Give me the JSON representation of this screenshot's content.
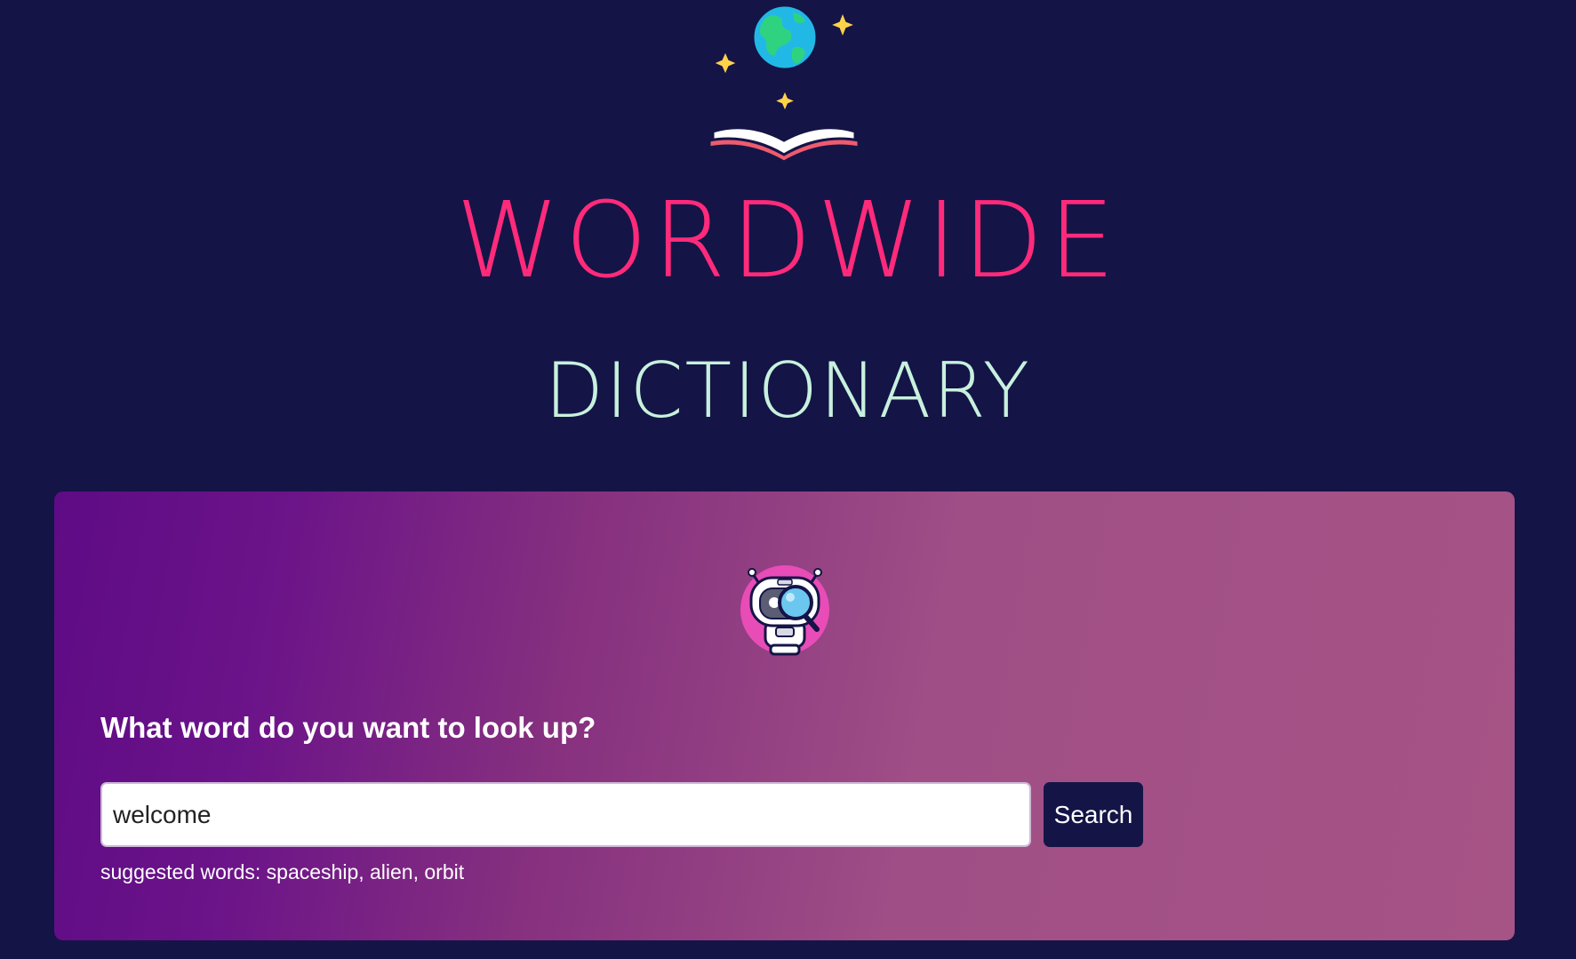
{
  "header": {
    "logo_icon": "book-globe-icon",
    "title": "WORDWIDE",
    "subtitle": "DICTIONARY"
  },
  "search": {
    "mascot_icon": "robot-magnifier-icon",
    "prompt": "What word do you want to look up?",
    "value": "welcome",
    "button_label": "Search",
    "suggested": "suggested words: spaceship, alien, orbit"
  },
  "colors": {
    "background": "#141447",
    "title": "#ff2a7a",
    "subtitle": "#c7f1dd",
    "button": "#141447"
  }
}
